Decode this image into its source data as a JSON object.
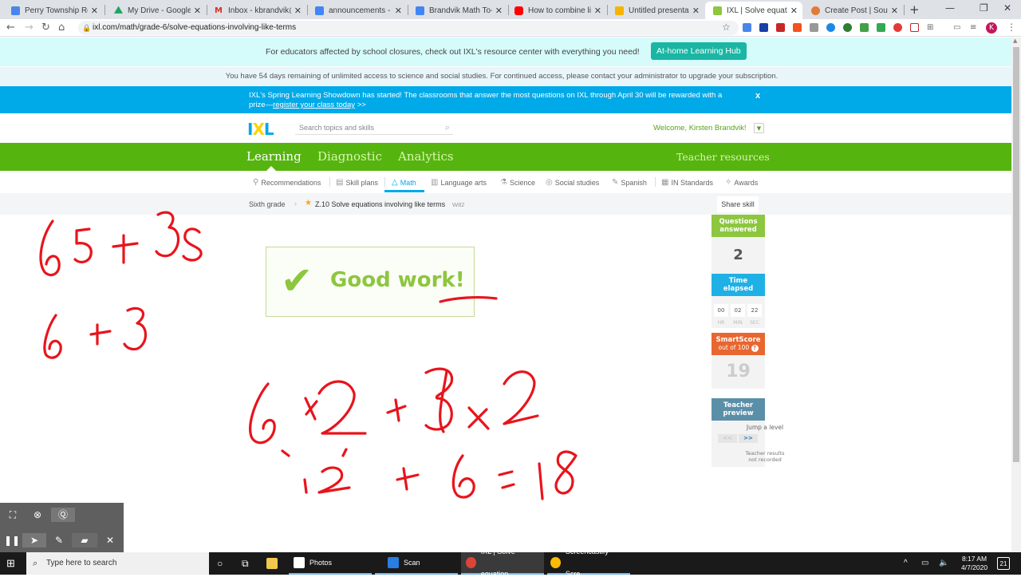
{
  "browser": {
    "tabs": [
      {
        "title": "Perry Township Resourc",
        "favicon": "doc-icon",
        "color": "#4a86e8"
      },
      {
        "title": "My Drive - Google Driv",
        "favicon": "drive-icon",
        "color": "#1fa463"
      },
      {
        "title": "Inbox - kbrandvik@per",
        "favicon": "gmail-icon",
        "color": "#d93025"
      },
      {
        "title": "announcements - Goog",
        "favicon": "docs-icon",
        "color": "#4285f4"
      },
      {
        "title": "Brandvik Math To- Do L",
        "favicon": "docs-icon",
        "color": "#4285f4"
      },
      {
        "title": "How to combine like te",
        "favicon": "youtube-icon",
        "color": "#ff0000"
      },
      {
        "title": "Untitled presentation -",
        "favicon": "slides-icon",
        "color": "#f4b400"
      },
      {
        "title": "IXL | Solve equations in",
        "favicon": "ixl-icon",
        "color": "#8dc63f",
        "active": true
      },
      {
        "title": "Create Post | Southport",
        "favicon": "app-icon",
        "color": "#e07b39"
      }
    ],
    "url": "ixl.com/math/grade-6/solve-equations-involving-like-terms",
    "profile_initial": "K"
  },
  "banners": {
    "educators_text": "For educators affected by school closures, check out IXL's resource center with everything you need!",
    "hub_button": "At-home Learning Hub",
    "access_text": "You have 54 days remaining of unlimited access to science and social studies. For continued access, please contact your administrator to upgrade your subscription.",
    "showdown_line1": "IXL's Spring Learning Showdown has started! The classrooms that answer the most questions on IXL through April 30 will be rewarded with a",
    "showdown_prefix": "prize—",
    "showdown_link": "register your class today",
    "showdown_suffix": " >>",
    "close": "x"
  },
  "header": {
    "logo": {
      "i": "I",
      "x": "X",
      "l": "L"
    },
    "search_placeholder": "Search topics and skills",
    "welcome": "Welcome, Kirsten Brandvik!"
  },
  "main_nav": {
    "items": [
      "Learning",
      "Diagnostic",
      "Analytics"
    ],
    "active": "Learning",
    "teacher_resources": "Teacher resources"
  },
  "sub_nav": {
    "items": [
      {
        "label": "Recommendations",
        "icon": "recommendations-icon"
      },
      {
        "label": "Skill plans",
        "icon": "skill-plans-icon"
      },
      {
        "label": "Math",
        "icon": "math-icon",
        "active": true
      },
      {
        "label": "Language arts",
        "icon": "language-arts-icon"
      },
      {
        "label": "Science",
        "icon": "science-icon"
      },
      {
        "label": "Social studies",
        "icon": "social-studies-icon"
      },
      {
        "label": "Spanish",
        "icon": "spanish-icon"
      },
      {
        "label": "IN Standards",
        "icon": "standards-icon"
      },
      {
        "label": "Awards",
        "icon": "awards-icon"
      }
    ]
  },
  "breadcrumb": {
    "grade": "Sixth grade",
    "skill": "Z.10 Solve equations involving like terms",
    "code": "W82",
    "share": "Share skill"
  },
  "feedback": {
    "message": "Good work!"
  },
  "side_panel": {
    "questions_label_1": "Questions",
    "questions_label_2": "answered",
    "questions_value": "2",
    "time_label_1": "Time",
    "time_label_2": "elapsed",
    "time": {
      "hr": "00",
      "min": "02",
      "sec": "22"
    },
    "time_units": {
      "hr": "HR",
      "min": "MIN",
      "sec": "SEC"
    },
    "smartscore_label": "SmartScore",
    "smartscore_sub": "out of 100",
    "smartscore_value": "19",
    "teacher_label_1": "Teacher",
    "teacher_label_2": "preview",
    "jump": "Jump a level",
    "prev": "<<",
    "next": ">>",
    "note_1": "Teacher results",
    "note_2": "not recorded"
  },
  "annotations": {
    "line1": "6s + 3s",
    "line2": "6 + 3",
    "line3": "6×2 + 3×2",
    "line4": "12 + 6 = 18",
    "ink_color": "#e8141c"
  },
  "screencastify": {
    "buttons": [
      "focus",
      "cursor-highlight",
      "click-highlight",
      "pause",
      "pointer",
      "pen",
      "eraser",
      "close"
    ]
  },
  "taskbar": {
    "search_placeholder": "Type here to search",
    "apps": [
      {
        "label": "Photos",
        "icon": "photos-icon"
      },
      {
        "label": "Scan",
        "icon": "scan-icon"
      },
      {
        "label": "IXL | Solve equation...",
        "icon": "chrome-icon"
      },
      {
        "label": "Screencastify - Scre...",
        "icon": "chrome-icon"
      }
    ],
    "time": "8:17 AM",
    "date": "4/7/2020",
    "notifications": "21"
  }
}
